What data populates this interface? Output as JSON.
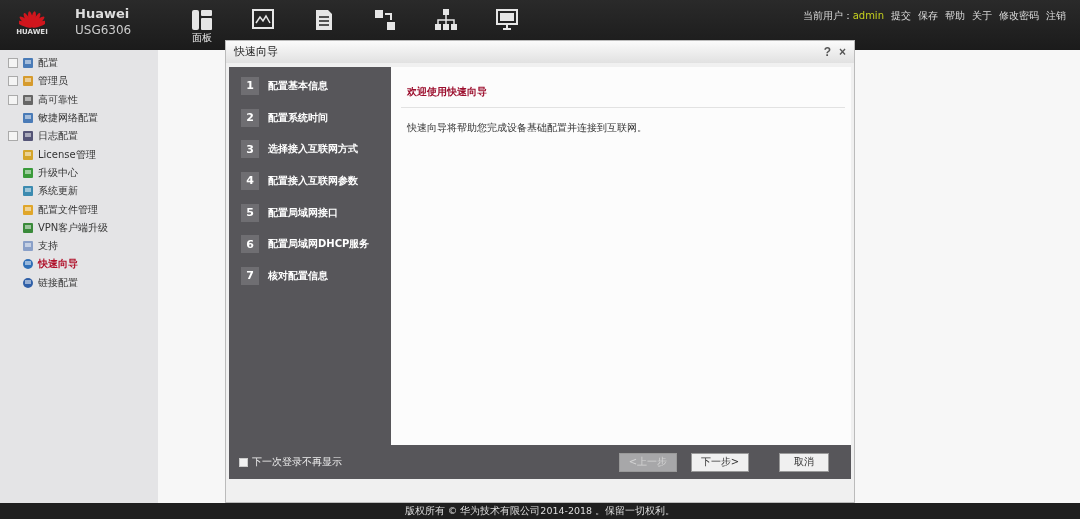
{
  "header": {
    "brand": "HUAWEI",
    "product": "Huawei",
    "model": "USG6306",
    "nav_label": "面板",
    "user_label": "当前用户：",
    "user": "admin",
    "links": [
      "提交",
      "保存",
      "帮助",
      "关于",
      "修改密码",
      "注销"
    ]
  },
  "sidebar": {
    "items": [
      {
        "label": "配置",
        "kind": "group",
        "selected": false
      },
      {
        "label": "管理员",
        "kind": "group",
        "selected": false
      },
      {
        "label": "高可靠性",
        "kind": "group",
        "selected": false
      },
      {
        "label": "敏捷网络配置",
        "kind": "leaf",
        "selected": false
      },
      {
        "label": "日志配置",
        "kind": "group",
        "selected": false
      },
      {
        "label": "License管理",
        "kind": "leaf",
        "selected": false
      },
      {
        "label": "升级中心",
        "kind": "leaf",
        "selected": false
      },
      {
        "label": "系统更新",
        "kind": "leaf",
        "selected": false
      },
      {
        "label": "配置文件管理",
        "kind": "leaf",
        "selected": false
      },
      {
        "label": "VPN客户端升级",
        "kind": "leaf",
        "selected": false
      },
      {
        "label": "支持",
        "kind": "leaf",
        "selected": false
      },
      {
        "label": "快速向导",
        "kind": "leaf",
        "selected": true
      },
      {
        "label": "链接配置",
        "kind": "leaf",
        "selected": false
      }
    ]
  },
  "dialog": {
    "title": "快速向导",
    "help": "?",
    "close": "×",
    "steps": [
      {
        "number": "1",
        "label": "配置基本信息"
      },
      {
        "number": "2",
        "label": "配置系统时间"
      },
      {
        "number": "3",
        "label": "选择接入互联网方式"
      },
      {
        "number": "4",
        "label": "配置接入互联网参数"
      },
      {
        "number": "5",
        "label": "配置局域网接口"
      },
      {
        "number": "6",
        "label": "配置局域网DHCP服务"
      },
      {
        "number": "7",
        "label": "核对配置信息"
      }
    ],
    "heading": "欢迎使用快速向导",
    "text": "快速向导将帮助您完成设备基础配置并连接到互联网。",
    "checkbox": {
      "label": "下一次登录不再显示",
      "checked": false
    },
    "buttons": [
      {
        "label": "<上一步",
        "disabled": true
      },
      {
        "label": "下一步>",
        "disabled": false
      },
      {
        "label": "取消",
        "disabled": false
      }
    ]
  },
  "footer": "版权所有 © 华为技术有限公司2014-2018 。保留一切权利。"
}
